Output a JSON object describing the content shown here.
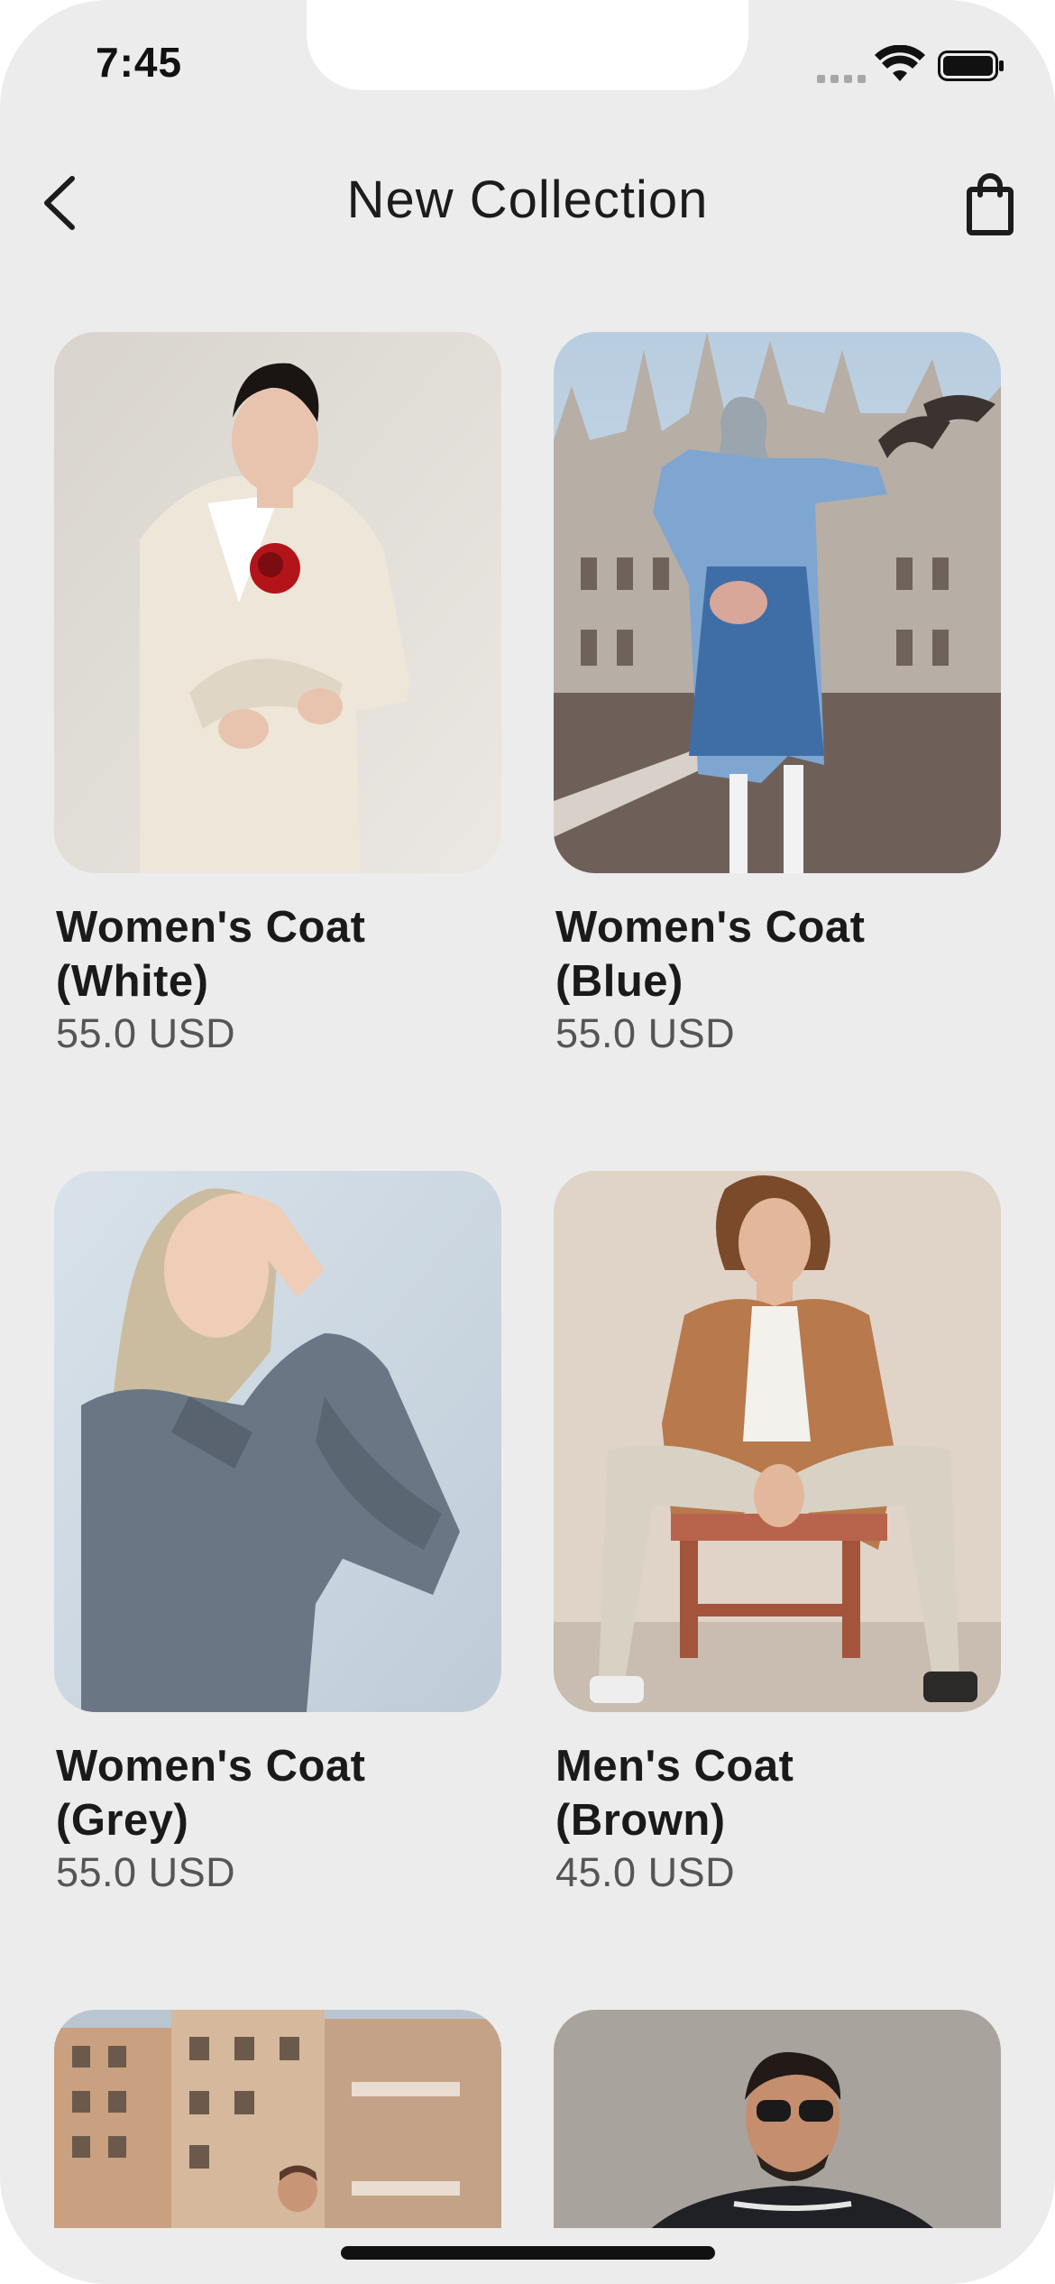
{
  "status_bar": {
    "time": "7:45"
  },
  "header": {
    "title": "New Collection",
    "back_icon": "chevron-left-icon",
    "cart_icon": "shopping-bag-icon"
  },
  "products": [
    {
      "name": "Women's Coat\n(White)",
      "price": "55.0 USD",
      "image": "woman-white-coat-photo"
    },
    {
      "name": "Women's Coat\n(Blue)",
      "price": "55.0 USD",
      "image": "woman-blue-coat-photo"
    },
    {
      "name": "Women's Coat\n(Grey)",
      "price": "55.0 USD",
      "image": "woman-grey-coat-photo"
    },
    {
      "name": "Men's Coat\n(Brown)",
      "price": "45.0 USD",
      "image": "man-brown-coat-photo"
    },
    {
      "name": "",
      "price": "",
      "image": "man-city-buildings-photo"
    },
    {
      "name": "",
      "price": "",
      "image": "man-sunglasses-photo"
    }
  ],
  "colors": {
    "background": "#ececec",
    "text_primary": "#1a1a1a",
    "text_secondary": "#555555"
  }
}
